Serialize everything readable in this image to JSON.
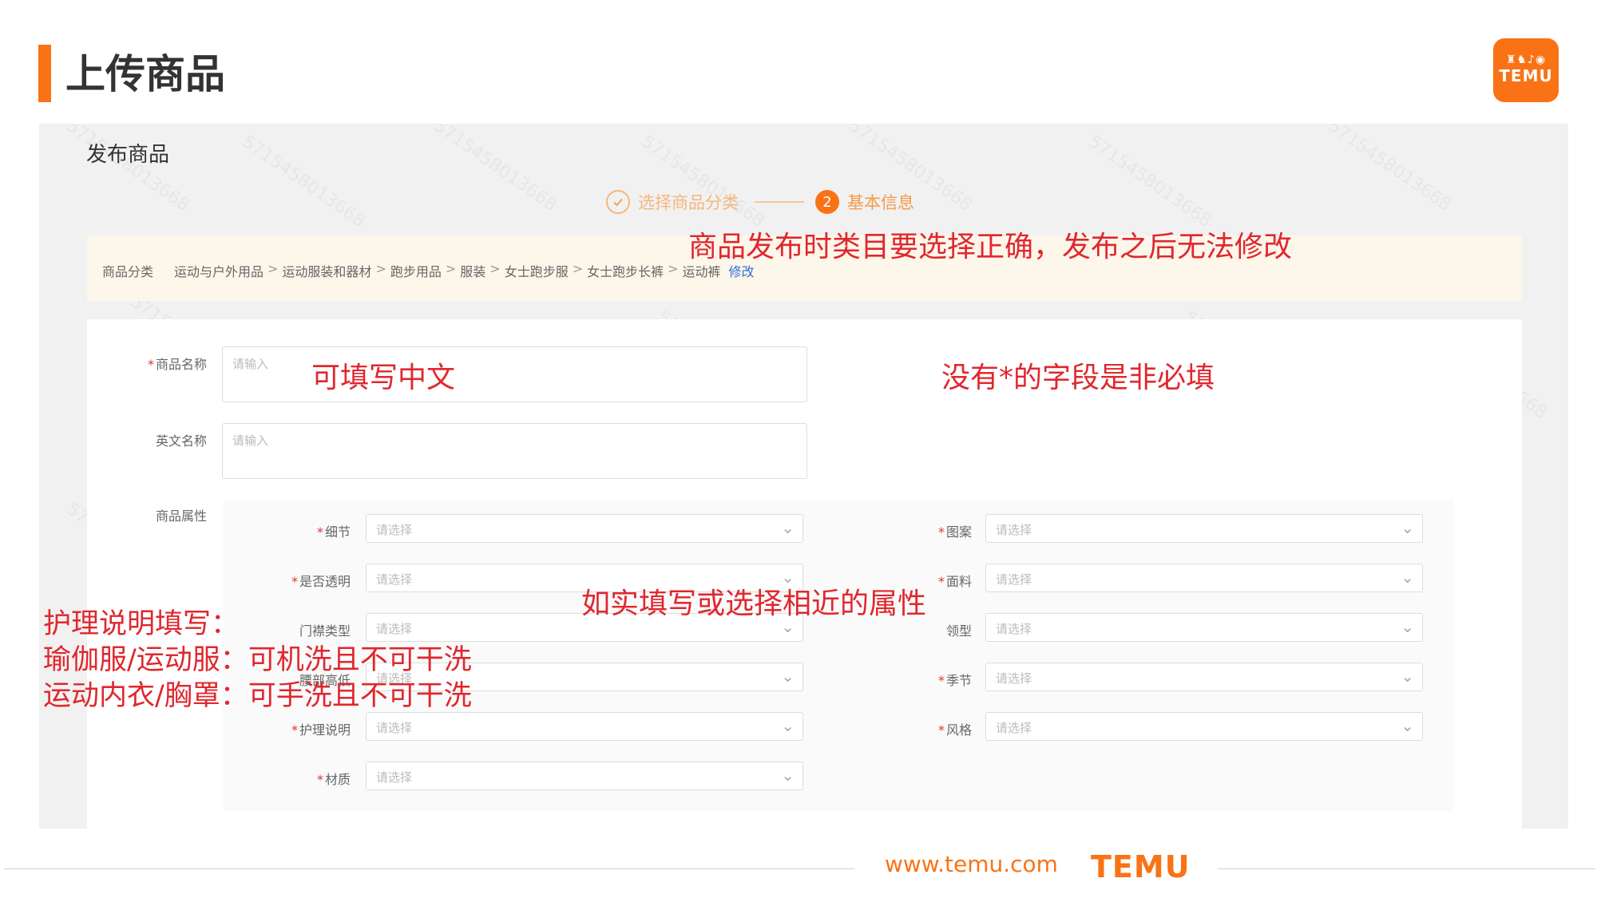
{
  "slide": {
    "title": "上传商品",
    "logo": {
      "glyphs": "♜♞♪◉",
      "word": "TEMU"
    }
  },
  "page": {
    "heading": "发布商品",
    "watermark": "5715458013668"
  },
  "steps": [
    {
      "label": "选择商品分类",
      "state": "done",
      "icon": "check-icon"
    },
    {
      "label": "基本信息",
      "state": "active",
      "number": "2"
    }
  ],
  "category": {
    "label": "商品分类",
    "path": [
      "运动与户外用品",
      "运动服装和器材",
      "跑步用品",
      "服装",
      "女士跑步服",
      "女士跑步长裤",
      "运动裤"
    ],
    "separator": ">",
    "edit_label": "修改"
  },
  "form": {
    "name_label": "商品名称",
    "name_placeholder": "请输入",
    "en_name_label": "英文名称",
    "en_name_placeholder": "请输入",
    "attrs_label": "商品属性",
    "required_mark": "*",
    "select_placeholder": "请选择",
    "chevron": "⌄",
    "attributes_left": [
      {
        "label": "细节",
        "required": true
      },
      {
        "label": "是否透明",
        "required": true
      },
      {
        "label": "门襟类型",
        "required": false
      },
      {
        "label": "腰部高低",
        "required": false
      },
      {
        "label": "护理说明",
        "required": true
      },
      {
        "label": "材质",
        "required": true
      }
    ],
    "attributes_right": [
      {
        "label": "图案",
        "required": true
      },
      {
        "label": "面料",
        "required": true
      },
      {
        "label": "领型",
        "required": false
      },
      {
        "label": "季节",
        "required": true
      },
      {
        "label": "风格",
        "required": true
      }
    ]
  },
  "annotations": {
    "category_note": "商品发布时类目要选择正确，发布之后无法修改",
    "name_note": "可填写中文",
    "optional_note": "没有*的字段是非必填",
    "attr_note": "如实填写或选择相近的属性",
    "care_note_1": "护理说明填写：",
    "care_note_2": "瑜伽服/运动服：可机洗且不可干洗",
    "care_note_3": "运动内衣/胸罩：可手洗且不可干洗"
  },
  "footer": {
    "url": "www.temu.com",
    "logo": "TEMU"
  },
  "colors": {
    "accent": "#f97316",
    "annotation": "#e0272e",
    "link": "#2f6fd6"
  }
}
